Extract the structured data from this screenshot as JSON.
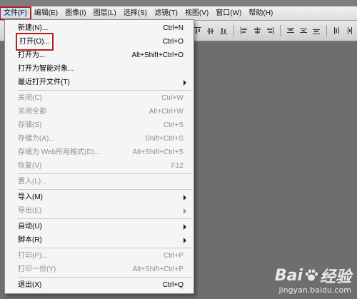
{
  "menubar": {
    "items": [
      "文件(F)",
      "编辑(E)",
      "图像(I)",
      "图层(L)",
      "选择(S)",
      "滤镜(T)",
      "视图(V)",
      "窗口(W)",
      "帮助(H)"
    ]
  },
  "file_menu": {
    "items": [
      {
        "label": "新建(N)...",
        "shortcut": "Ctrl+N"
      },
      {
        "label": "打开(O)...",
        "shortcut": "Ctrl+O"
      },
      {
        "label": "打开为...",
        "shortcut": "Alt+Shift+Ctrl+O"
      },
      {
        "label": "打开为智能对象...",
        "shortcut": ""
      },
      {
        "label": "最近打开文件(T)",
        "shortcut": ""
      },
      {
        "label": "关闭(C)",
        "shortcut": "Ctrl+W"
      },
      {
        "label": "关闭全部",
        "shortcut": "Alt+Ctrl+W"
      },
      {
        "label": "存储(S)",
        "shortcut": "Ctrl+S"
      },
      {
        "label": "存储为(A)...",
        "shortcut": "Shift+Ctrl+S"
      },
      {
        "label": "存储为 Web所用格式(D)...",
        "shortcut": "Alt+Shift+Ctrl+S"
      },
      {
        "label": "恢复(V)",
        "shortcut": "F12"
      },
      {
        "label": "置入(L)...",
        "shortcut": ""
      },
      {
        "label": "导入(M)",
        "shortcut": ""
      },
      {
        "label": "导出(E)",
        "shortcut": ""
      },
      {
        "label": "自动(U)",
        "shortcut": ""
      },
      {
        "label": "脚本(R)",
        "shortcut": ""
      },
      {
        "label": "打印(P)...",
        "shortcut": "Ctrl+P"
      },
      {
        "label": "打印一份(Y)",
        "shortcut": "Alt+Shift+Ctrl+P"
      },
      {
        "label": "退出(X)",
        "shortcut": "Ctrl+Q"
      }
    ]
  },
  "toolbar_icons": [
    "align-top-icon",
    "align-vcenter-icon",
    "align-bottom-icon",
    "align-left-icon",
    "align-hcenter-icon",
    "align-right-icon",
    "distribute-top-icon",
    "distribute-vcenter-icon",
    "distribute-bottom-icon",
    "distribute-left-icon",
    "distribute-hcenter-icon",
    "distribute-right-icon"
  ],
  "watermark": {
    "main_left": "Bai",
    "main_right": "经验",
    "sub": "jingyan.baidu.com"
  },
  "colors": {
    "highlight_box": "#b3211e",
    "canvas": "#6e6e6e",
    "menu_bg": "#f5f5f5",
    "disabled_text": "#8f8f8f"
  }
}
